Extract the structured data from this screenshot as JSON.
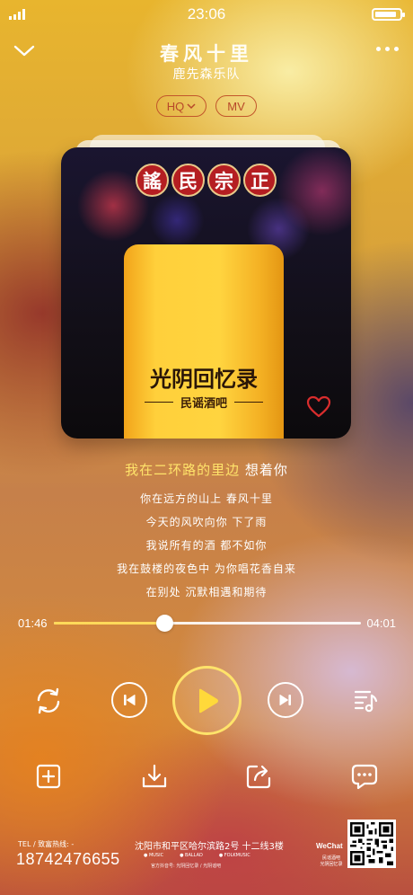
{
  "status_bar": {
    "time": "23:06",
    "battery_level": 0.9
  },
  "header": {
    "title": "春风十里",
    "artist": "鹿先森乐队"
  },
  "quality_chips": {
    "hq": "HQ",
    "mv": "MV"
  },
  "cover": {
    "seal_chars": [
      "謠",
      "民",
      "宗",
      "正"
    ],
    "title": "光阴回忆录",
    "subtitle": "民谣酒吧"
  },
  "lyrics": {
    "current_sung": "我在二环路的里边",
    "current_rest": " 想着你",
    "lines": [
      "你在远方的山上 春风十里",
      "今天的风吹向你 下了雨",
      "我说所有的酒 都不如你",
      "我在鼓楼的夜色中 为你唱花香自来",
      "在别处 沉默相遇和期待"
    ]
  },
  "progress": {
    "current": "01:46",
    "total": "04:01",
    "fraction": 0.36
  },
  "footer": {
    "tel_label": "TEL / 致富热线: -",
    "tel_number": "18742476655",
    "address": "沈阳市和平区哈尔滨路2号 十二线3楼",
    "tags": [
      "MUSIC",
      "BALLAD",
      "FOLKMUSIC"
    ],
    "footnote": "官方抖音号: 光阴回忆录 / 光阴谣吧",
    "wechat": "WeChat",
    "wechat_sub": "民谣酒吧 光阴回忆录"
  },
  "colors": {
    "accent": "#ffe36a",
    "chip": "#c2562b",
    "heart": "#d92d2d"
  }
}
